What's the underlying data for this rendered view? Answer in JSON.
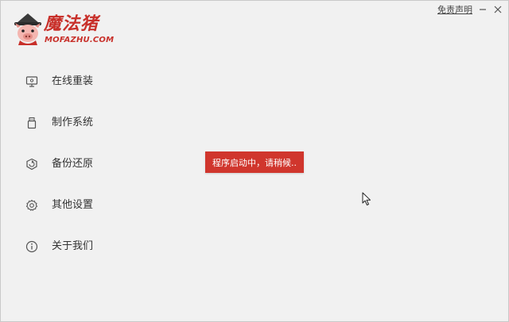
{
  "logo": {
    "name_cn": "魔法猪",
    "name_en": "MOFAZHU.COM"
  },
  "titlebar": {
    "disclaimer_label": "免责声明",
    "minimize_icon": "minimize-icon",
    "close_icon": "close-icon"
  },
  "sidebar": {
    "items": [
      {
        "label": "在线重装",
        "icon": "monitor-icon"
      },
      {
        "label": "制作系统",
        "icon": "usb-drive-icon"
      },
      {
        "label": "备份还原",
        "icon": "backup-restore-icon"
      },
      {
        "label": "其他设置",
        "icon": "gear-icon"
      },
      {
        "label": "关于我们",
        "icon": "info-icon"
      }
    ]
  },
  "toast": {
    "message": "程序启动中，请稍候..",
    "color": "#d0362d"
  },
  "colors": {
    "brand": "#c8302a",
    "background": "#f1f1f1"
  }
}
